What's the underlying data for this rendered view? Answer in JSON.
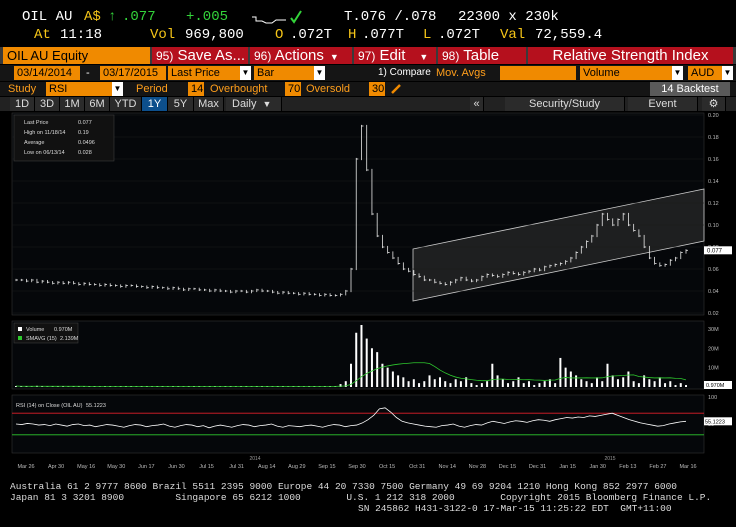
{
  "quote": {
    "ticker": "OIL AU",
    "currency": "A$",
    "arrow": "↑",
    "last": ".077",
    "change": "+.005",
    "tick_icon": "check-icon",
    "trade_time": "T.076 /.078",
    "size": "22300 x 230k",
    "at_label": "At",
    "at_time": "11:18",
    "vol_label": "Vol",
    "volume": "969,800",
    "open_label": "O",
    "open": ".072T",
    "high_label": "H",
    "high": ".077T",
    "low_label": "L",
    "low": ".072T",
    "val_label": "Val",
    "value": "72,559.4"
  },
  "toolbar": {
    "security": "OIL AU Equity",
    "save_num": "95)",
    "save": "Save As...",
    "actions_num": "96)",
    "actions": "Actions",
    "edit_num": "97)",
    "edit": "Edit",
    "table_num": "98)",
    "table": "Table",
    "title": "Relative Strength Index"
  },
  "params": {
    "start_date": "03/14/2014",
    "dash": "-",
    "end_date": "03/17/2015",
    "price_field": "Last Price",
    "chart_style": "Bar",
    "compare_label": "1) Compare",
    "compare_value": "Mov. Avgs",
    "volume_field": "Volume",
    "currency": "AUD"
  },
  "study": {
    "study_label": "Study",
    "study_value": "RSI",
    "period_label": "Period",
    "period_value": "14",
    "overbought_label": "Overbought",
    "overbought_value": "70",
    "oversold_label": "Oversold",
    "oversold_value": "30",
    "backtest": "14 Backtest"
  },
  "ranges": {
    "items": [
      "1D",
      "3D",
      "1M",
      "6M",
      "YTD",
      "1Y",
      "5Y",
      "Max"
    ],
    "active": "1Y",
    "period": "Daily",
    "security_study": "Security/Study",
    "event": "Event"
  },
  "legend": {
    "price_title": "Last Price",
    "price_value": "0.077",
    "high": "High on 11/18/14",
    "high_value": "0.19",
    "average": "Average",
    "average_value": "0.0496",
    "low": "Low on 06/13/14",
    "low_value": "0.028",
    "volume_title": "Volume",
    "volume_value": "0.970M",
    "smavg_title": "SMAVG (15)",
    "smavg_value": "2.139M",
    "rsi_title": "RSI (14) on Close (OIL AU)",
    "rsi_value": "55.1223"
  },
  "chart_data": {
    "type": "bar",
    "price_axis": [
      0.2,
      0.18,
      0.16,
      0.14,
      0.12,
      0.1,
      0.08,
      0.06,
      0.04,
      0.02
    ],
    "price_ylim": [
      0.02,
      0.2
    ],
    "last_price_label": "0.077",
    "volume_axis": [
      "30M",
      "20M",
      "10M"
    ],
    "volume_ylim": [
      0,
      32
    ],
    "last_volume_label": "0.970M",
    "rsi_axis": [
      100,
      50
    ],
    "rsi_ylim": [
      0,
      100
    ],
    "last_rsi_label": "55.1223",
    "overbought": 70,
    "oversold": 30,
    "x_ticks": [
      "Mar 26",
      "Apr 30",
      "May 16",
      "May 30",
      "Jun 17",
      "Jun 30",
      "Jul 15",
      "Jul 31",
      "Aug 14",
      "Aug 29",
      "Sep 15",
      "Sep 30",
      "Oct 15",
      "Oct 31",
      "Nov 14",
      "Nov 28",
      "Dec 15",
      "Dec 31",
      "Jan 15",
      "Jan 30",
      "Feb 13",
      "Feb 27",
      "Mar 16"
    ],
    "year_labels": [
      "2014",
      "2015"
    ],
    "price_close": [
      0.05,
      0.05,
      0.049,
      0.05,
      0.048,
      0.049,
      0.048,
      0.047,
      0.048,
      0.047,
      0.048,
      0.047,
      0.046,
      0.047,
      0.046,
      0.046,
      0.045,
      0.046,
      0.045,
      0.045,
      0.044,
      0.045,
      0.045,
      0.044,
      0.044,
      0.043,
      0.044,
      0.043,
      0.043,
      0.042,
      0.043,
      0.042,
      0.041,
      0.042,
      0.042,
      0.041,
      0.041,
      0.04,
      0.041,
      0.04,
      0.04,
      0.039,
      0.04,
      0.04,
      0.039,
      0.04,
      0.041,
      0.04,
      0.04,
      0.039,
      0.038,
      0.039,
      0.038,
      0.038,
      0.037,
      0.038,
      0.037,
      0.037,
      0.036,
      0.037,
      0.036,
      0.036,
      0.037,
      0.04,
      0.06,
      0.16,
      0.19,
      0.15,
      0.11,
      0.09,
      0.08,
      0.075,
      0.07,
      0.065,
      0.06,
      0.058,
      0.055,
      0.053,
      0.05,
      0.05,
      0.048,
      0.047,
      0.046,
      0.048,
      0.05,
      0.052,
      0.05,
      0.049,
      0.05,
      0.053,
      0.055,
      0.054,
      0.053,
      0.055,
      0.057,
      0.056,
      0.055,
      0.057,
      0.058,
      0.06,
      0.059,
      0.062,
      0.063,
      0.064,
      0.065,
      0.067,
      0.07,
      0.075,
      0.08,
      0.085,
      0.09,
      0.1,
      0.11,
      0.105,
      0.1,
      0.105,
      0.11,
      0.1,
      0.095,
      0.09,
      0.08,
      0.07,
      0.065,
      0.063,
      0.064,
      0.068,
      0.07,
      0.075,
      0.077
    ],
    "volume": [
      0.5,
      0.3,
      0.4,
      0.2,
      0.6,
      0.3,
      0.2,
      0.4,
      0.3,
      0.5,
      0.2,
      0.3,
      0.4,
      0.2,
      0.3,
      0.5,
      0.2,
      0.4,
      0.3,
      0.2,
      0.5,
      0.3,
      0.4,
      0.2,
      0.3,
      0.5,
      0.2,
      0.4,
      0.3,
      0.2,
      0.4,
      0.3,
      0.2,
      0.5,
      0.3,
      0.4,
      0.2,
      0.3,
      0.5,
      0.2,
      0.4,
      0.3,
      0.2,
      0.4,
      0.3,
      0.2,
      0.5,
      0.3,
      0.4,
      0.2,
      0.3,
      0.5,
      0.2,
      0.4,
      0.3,
      0.2,
      0.4,
      0.3,
      0.2,
      0.5,
      0.3,
      0.4,
      1.5,
      3,
      12,
      28,
      32,
      25,
      20,
      18,
      12,
      10,
      8,
      6,
      5,
      3,
      4,
      2,
      3,
      6,
      4,
      5,
      3,
      2,
      4,
      3,
      5,
      2,
      1,
      2,
      3,
      12,
      6,
      4,
      2,
      3,
      5,
      2,
      3,
      1,
      2,
      3,
      4,
      2,
      15,
      10,
      8,
      6,
      4,
      3,
      2,
      5,
      3,
      12,
      6,
      4,
      5,
      8,
      3,
      2,
      6,
      4,
      3,
      5,
      2,
      3,
      1,
      2,
      1
    ],
    "rsi": [
      50,
      49,
      51,
      50,
      48,
      49,
      47,
      50,
      48,
      46,
      49,
      50,
      47,
      48,
      45,
      47,
      49,
      48,
      46,
      44,
      47,
      49,
      48,
      45,
      47,
      48,
      50,
      46,
      44,
      47,
      49,
      48,
      45,
      47,
      43,
      46,
      48,
      46,
      44,
      47,
      49,
      48,
      45,
      47,
      48,
      50,
      46,
      44,
      47,
      46,
      45,
      47,
      48,
      46,
      44,
      47,
      49,
      48,
      45,
      47,
      48,
      52,
      58,
      66,
      78,
      80,
      72,
      62,
      55,
      52,
      50,
      48,
      46,
      45,
      44,
      47,
      48,
      50,
      46,
      44,
      47,
      49,
      48,
      52,
      55,
      53,
      51,
      54,
      56,
      55,
      53,
      56,
      58,
      57,
      55,
      58,
      60,
      62,
      61,
      63,
      62,
      65,
      64,
      66,
      68,
      70,
      66,
      62,
      58,
      55,
      52,
      50,
      48,
      46,
      47,
      50,
      52,
      54,
      55
    ]
  },
  "footer": {
    "line1": "Australia 61 2 9777 8600 Brazil 5511 2395 9000 Europe 44 20 7330 7500 Germany 49 69 9204 1210 Hong Kong 852 2977 6000",
    "line2": "Japan 81 3 3201 8900         Singapore 65 6212 1000        U.S. 1 212 318 2000        Copyright 2015 Bloomberg Finance L.P.",
    "line3": "SN 245862 H431-3122-0 17-Mar-15 11:25:22 EDT  GMT+11:00"
  },
  "colors": {
    "accent_red": "#b5101d",
    "field_orange": "#f08a00",
    "price_green": "#33d33a",
    "label_yellow": "#f5c518",
    "rsi_red": "#e0202a",
    "sma_green": "#2ec82e"
  }
}
